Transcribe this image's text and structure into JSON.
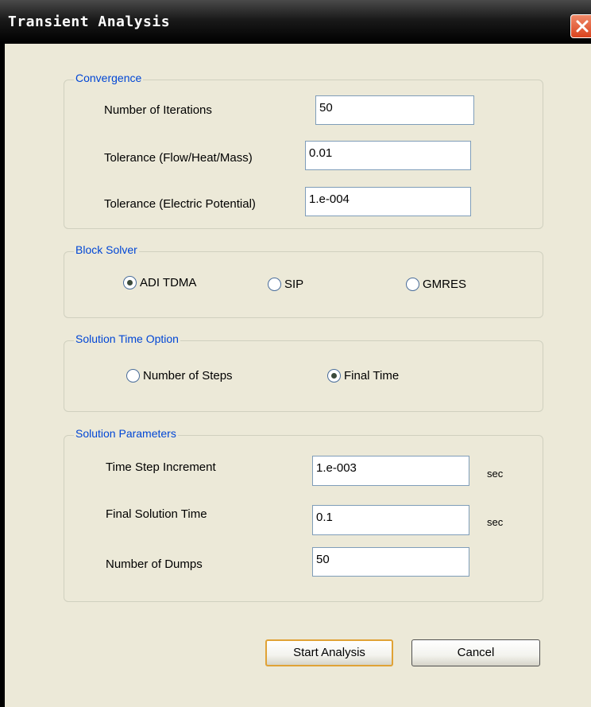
{
  "window": {
    "title": "Transient Analysis"
  },
  "convergence": {
    "legend": "Convergence",
    "iterations_label": "Number of Iterations",
    "iterations_value": "50",
    "tol_flow_label": "Tolerance (Flow/Heat/Mass)",
    "tol_flow_value": "0.01",
    "tol_elec_label": "Tolerance (Electric Potential)",
    "tol_elec_value": "1.e-004"
  },
  "block_solver": {
    "legend": "Block Solver",
    "options": [
      {
        "label": "ADI TDMA",
        "selected": true
      },
      {
        "label": "SIP",
        "selected": false
      },
      {
        "label": "GMRES",
        "selected": false
      }
    ]
  },
  "solution_time": {
    "legend": "Solution Time Option",
    "options": [
      {
        "label": "Number of Steps",
        "selected": false
      },
      {
        "label": "Final Time",
        "selected": true
      }
    ]
  },
  "solution_params": {
    "legend": "Solution Parameters",
    "time_step_label": "Time Step Increment",
    "time_step_value": "1.e-003",
    "time_step_unit": "sec",
    "final_time_label": "Final Solution Time",
    "final_time_value": "0.1",
    "final_time_unit": "sec",
    "dumps_label": "Number of Dumps",
    "dumps_value": "50"
  },
  "buttons": {
    "start": "Start Analysis",
    "cancel": "Cancel"
  },
  "icons": {
    "close": "close-icon",
    "radio": "radio-icon"
  }
}
